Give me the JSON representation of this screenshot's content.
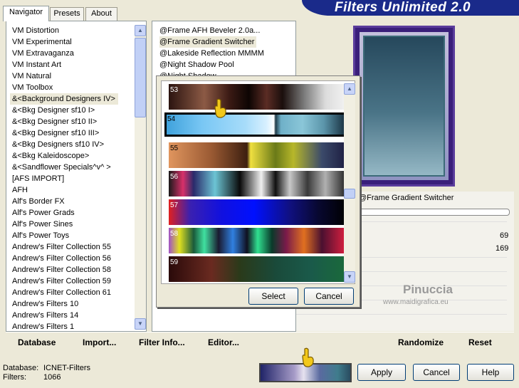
{
  "title": "Filters Unlimited 2.0",
  "tabs": [
    "Navigator",
    "Presets",
    "About"
  ],
  "categories": [
    "VM Distortion",
    "VM Experimental",
    "VM Extravaganza",
    "VM Instant Art",
    "VM Natural",
    "VM Toolbox",
    "&<Background Designers IV>",
    "&<Bkg Designer sf10 I>",
    "&<Bkg Designer sf10 II>",
    "&<Bkg Designer sf10 III>",
    "&<Bkg Designers sf10 IV>",
    "&<Bkg Kaleidoscope>",
    "&<Sandflower Specials^v^ >",
    "[AFS IMPORT]",
    "AFH",
    "Alf's Border FX",
    "Alf's Power Grads",
    "Alf's Power Sines",
    "Alf's Power Toys",
    "Andrew's Filter Collection 55",
    "Andrew's Filter Collection 56",
    "Andrew's Filter Collection 58",
    "Andrew's Filter Collection 59",
    "Andrew's Filter Collection 61",
    "Andrew's Filters 10",
    "Andrew's Filters 14",
    "Andrew's Filters 1"
  ],
  "filters": [
    "@Frame AFH Beveler 2.0a...",
    "@Frame Gradient Switcher",
    "@Lakeside Reflection MMMM",
    "@Night Shadow Pool",
    "@Night Shadow"
  ],
  "filter_name": "@Frame Gradient Switcher",
  "params": [
    "69",
    "169"
  ],
  "gradients": [
    "53",
    "54",
    "55",
    "56",
    "57",
    "58",
    "59"
  ],
  "dialog": {
    "select": "Select",
    "cancel": "Cancel"
  },
  "bottom": {
    "database": "Database",
    "import": "Import...",
    "filter_info": "Filter Info...",
    "editor": "Editor...",
    "randomize": "Randomize",
    "reset": "Reset"
  },
  "status": {
    "db_label": "Database:",
    "db_value": "ICNET-Filters",
    "f_label": "Filters:",
    "f_value": "1066"
  },
  "buttons": {
    "apply": "Apply",
    "cancel": "Cancel",
    "help": "Help"
  },
  "watermark": {
    "name": "Pinuccia",
    "url": "www.maidigrafica.eu"
  }
}
